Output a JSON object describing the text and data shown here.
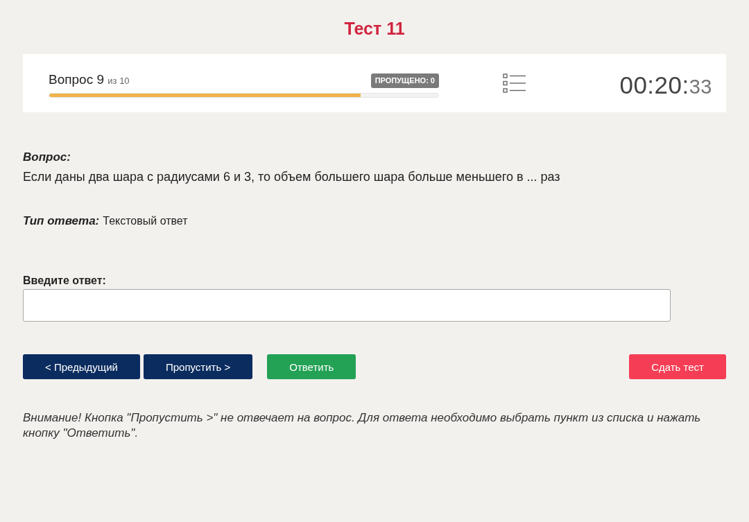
{
  "title": "Тест 11",
  "progress": {
    "counter": "Вопрос 9",
    "total": "из 10",
    "skipped_badge": "ПРОПУЩЕНО: 0",
    "level": 0.8
  },
  "timer": {
    "hours_minutes": "00:20:",
    "seconds": "33"
  },
  "question": {
    "label": "Вопрос:",
    "text": "Если даны два шара с радиусами 6 и 3, то объем большего шара больше меньшего в ... раз"
  },
  "answer_type": {
    "label": "Тип ответа:",
    "value": "Текстовый ответ"
  },
  "answer": {
    "label": "Введите ответ:"
  },
  "buttons": [
    {
      "label": "< Предыдущий",
      "kind": "nav"
    },
    {
      "label": "Пропустить >",
      "kind": "nav"
    },
    {
      "label": "Ответить",
      "kind": "submit"
    },
    {
      "label": "Сдать тест",
      "kind": "finish"
    }
  ],
  "notice": "Внимание! Кнопка \"Пропустить >\" не отвечает на вопрос. Для ответа необходимо выбрать пункт из списка и нажать кнопку \"Ответить\"."
}
